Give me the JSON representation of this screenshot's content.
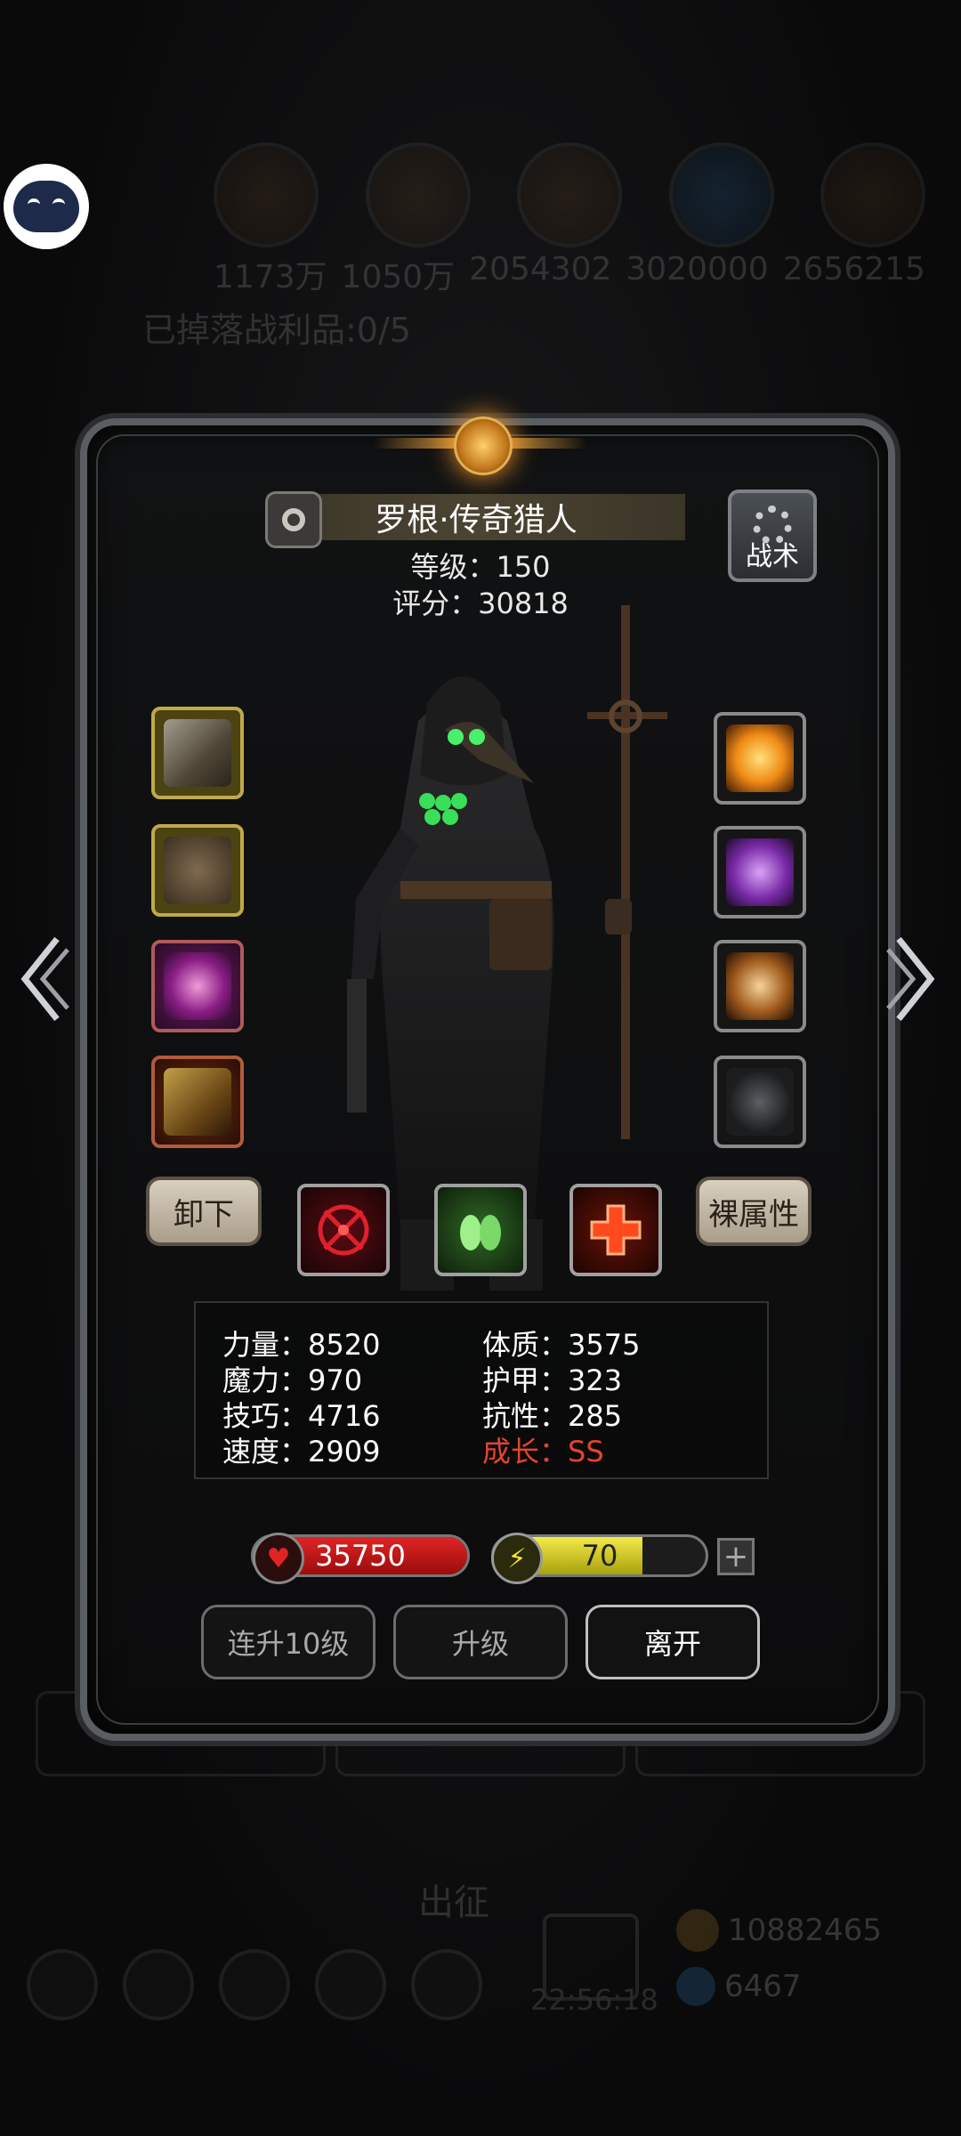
{
  "background": {
    "resources": [
      "1173万",
      "1050万",
      "2054302",
      "3020000",
      "2656215"
    ],
    "loot_status": "已掉落战利品:0/5",
    "tabs": [
      "",
      "",
      ""
    ],
    "march_label": "出征",
    "timer": "22:56:18",
    "gold": "10882465",
    "gems": "6467"
  },
  "hero": {
    "name": "罗根·传奇猎人",
    "level": "等级：150",
    "score": "评分：30818",
    "tactics_label": "战术"
  },
  "equipment": {
    "left": [
      "revolver-item-icon",
      "armor-item-icon",
      "amulet-item-icon",
      "bracer-item-icon"
    ],
    "right": [
      "fire-ring-item-icon",
      "crystal-item-icon",
      "lantern-item-icon",
      "glove-item-icon"
    ]
  },
  "buttons": {
    "unequip": "卸下",
    "base_attributes": "裸属性",
    "level_up_10": "连升10级",
    "level_up": "升级",
    "leave": "离开"
  },
  "stats": {
    "strength": "力量：8520",
    "magic": "魔力：970",
    "skill": "技巧：4716",
    "speed": "速度：2909",
    "constitution": "体质：3575",
    "armor": "护甲：323",
    "resistance": "抗性：285",
    "growth": "成长：SS"
  },
  "bars": {
    "hp": "35750",
    "hp_fill": 1.0,
    "energy": "70",
    "energy_fill": 0.7
  },
  "colors": {
    "hp": "#e02424",
    "energy": "#f3ea4a",
    "growth": "#e2452d"
  }
}
